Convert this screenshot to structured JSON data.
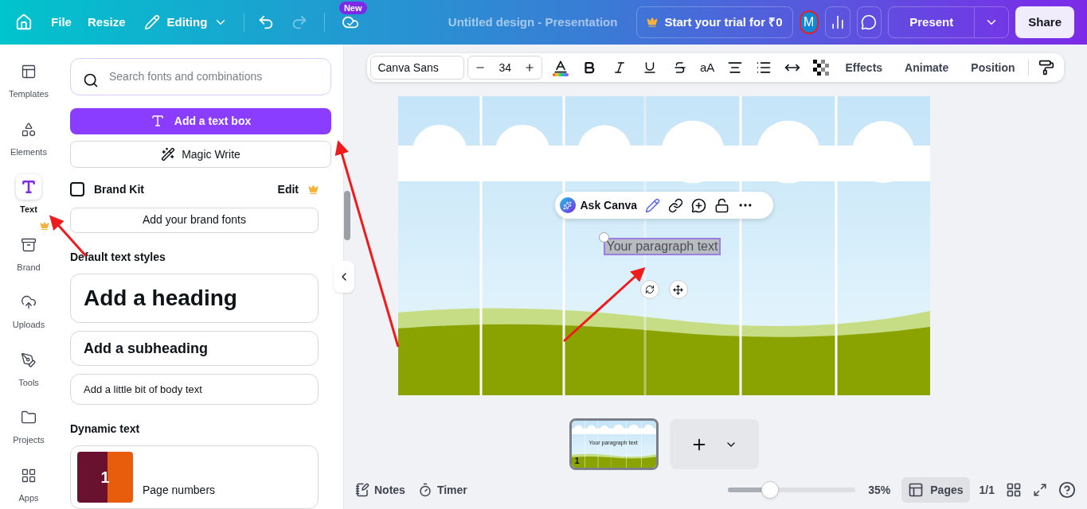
{
  "header": {
    "menu": [
      "File",
      "Resize"
    ],
    "mode": "Editing",
    "badge": "New",
    "doc_title": "Untitled design - Presentation",
    "trial": "Start your trial for ₹0",
    "avatar": "M",
    "present": "Present",
    "share": "Share"
  },
  "rail": [
    {
      "kind": "templates",
      "label": "Templates",
      "selected": false,
      "premium": false
    },
    {
      "kind": "elements",
      "label": "Elements",
      "selected": false,
      "premium": false
    },
    {
      "kind": "text",
      "label": "Text",
      "selected": true,
      "premium": false
    },
    {
      "kind": "brand",
      "label": "Brand",
      "selected": false,
      "premium": true
    },
    {
      "kind": "uploads",
      "label": "Uploads",
      "selected": false,
      "premium": false
    },
    {
      "kind": "tools",
      "label": "Tools",
      "selected": false,
      "premium": false
    },
    {
      "kind": "projects",
      "label": "Projects",
      "selected": false,
      "premium": false
    },
    {
      "kind": "apps",
      "label": "Apps",
      "selected": false,
      "premium": false
    }
  ],
  "panel": {
    "search": {
      "placeholder": "Search fonts and combinations"
    },
    "add_text_box": "Add a text box",
    "magic_write": "Magic Write",
    "brand_kit": {
      "title": "Brand Kit",
      "edit": "Edit",
      "premium": true
    },
    "brand_fonts": "Add your brand fonts",
    "styles_heading": "Default text styles",
    "styles": [
      {
        "kind": "heading",
        "label": "Add a heading"
      },
      {
        "kind": "subheading",
        "label": "Add a subheading"
      },
      {
        "kind": "body",
        "label": "Add a little bit of body text"
      }
    ],
    "dynamic_heading": "Dynamic text",
    "dynamic": [
      {
        "icon_text": "1",
        "label": "Page numbers"
      }
    ]
  },
  "toolbar": {
    "font": "Canva Sans",
    "size": "34",
    "case": "aA",
    "buttons": [
      "Effects",
      "Animate",
      "Position"
    ]
  },
  "canvas": {
    "ask": "Ask Canva",
    "textbox": {
      "text": "Your paragraph text",
      "selected": true
    }
  },
  "pages": {
    "thumbnails": [
      {
        "number": "1",
        "text": "Your paragraph text",
        "selected": true
      }
    ]
  },
  "footer": {
    "notes": "Notes",
    "timer": "Timer",
    "zoom": {
      "level": 0.33,
      "reading": "35%"
    },
    "pages": {
      "label": "Pages",
      "selected": true
    },
    "count": "1/1"
  }
}
